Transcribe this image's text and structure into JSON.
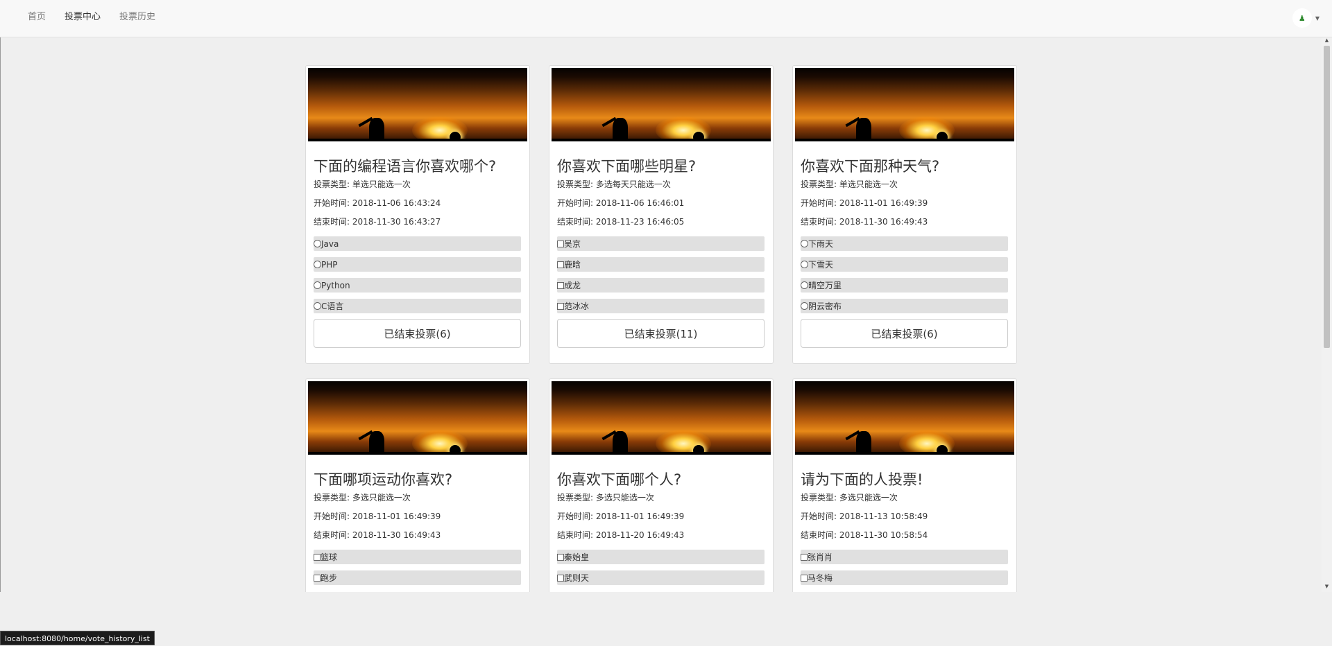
{
  "nav": {
    "items": [
      {
        "label": "首页",
        "active": false
      },
      {
        "label": "投票中心",
        "active": true
      },
      {
        "label": "投票历史",
        "active": false
      }
    ]
  },
  "user": {
    "avatar_icon": "user-avatar-icon",
    "menu_icon": "caret-down-icon"
  },
  "polls": [
    {
      "title": "下面的编程语言你喜欢哪个?",
      "type_line": "投票类型: 单选只能选一次",
      "start_line": "开始时间: 2018-11-06 16:43:24",
      "end_line": "结束时间: 2018-11-30 16:43:27",
      "input_type": "radio",
      "options": [
        "Java",
        "PHP",
        "Python",
        "C语言"
      ],
      "status": "已结束投票(6)"
    },
    {
      "title": "你喜欢下面哪些明星?",
      "type_line": "投票类型: 多选每天只能选一次",
      "start_line": "开始时间: 2018-11-06 16:46:01",
      "end_line": "结束时间: 2018-11-23 16:46:05",
      "input_type": "checkbox",
      "options": [
        "吴京",
        "鹿晗",
        "成龙",
        "范冰冰"
      ],
      "status": "已结束投票(11)"
    },
    {
      "title": "你喜欢下面那种天气?",
      "type_line": "投票类型: 单选只能选一次",
      "start_line": "开始时间: 2018-11-01 16:49:39",
      "end_line": "结束时间: 2018-11-30 16:49:43",
      "input_type": "radio",
      "options": [
        "下雨天",
        "下雪天",
        "晴空万里",
        "阴云密布"
      ],
      "status": "已结束投票(6)"
    },
    {
      "title": "下面哪项运动你喜欢?",
      "type_line": "投票类型: 多选只能选一次",
      "start_line": "开始时间: 2018-11-01 16:49:39",
      "end_line": "结束时间: 2018-11-30 16:49:43",
      "input_type": "checkbox",
      "options": [
        "篮球",
        "跑步"
      ],
      "status": ""
    },
    {
      "title": "你喜欢下面哪个人?",
      "type_line": "投票类型: 多选只能选一次",
      "start_line": "开始时间: 2018-11-01 16:49:39",
      "end_line": "结束时间: 2018-11-20 16:49:43",
      "input_type": "checkbox",
      "options": [
        "秦始皇",
        "武则天"
      ],
      "status": ""
    },
    {
      "title": "请为下面的人投票!",
      "type_line": "投票类型: 多选只能选一次",
      "start_line": "开始时间: 2018-11-13 10:58:49",
      "end_line": "结束时间: 2018-11-30 10:58:54",
      "input_type": "checkbox",
      "options": [
        "张肖肖",
        "马冬梅"
      ],
      "status": ""
    }
  ],
  "status_bar": {
    "url": "localhost:8080/home/vote_history_list"
  }
}
